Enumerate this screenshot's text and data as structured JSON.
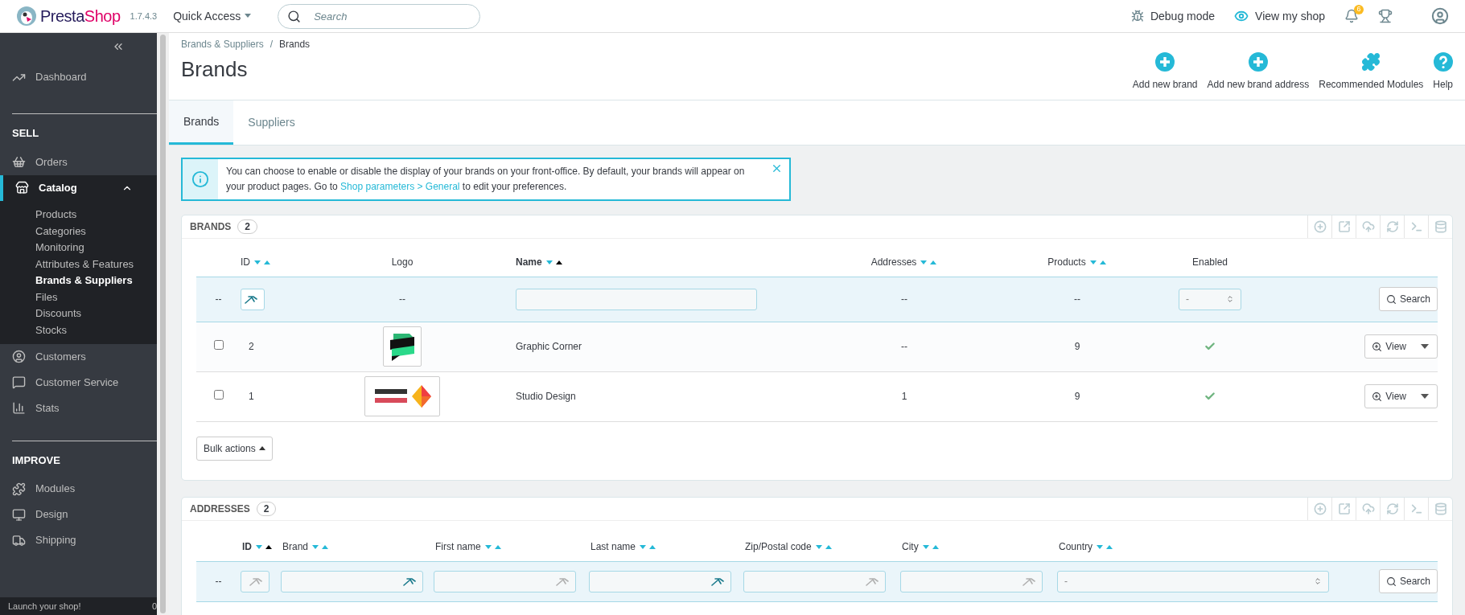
{
  "header": {
    "logo": {
      "first": "Presta",
      "second": "Shop"
    },
    "version": "1.7.4.3",
    "quick_access": "Quick Access",
    "search": {
      "placeholder": "Search"
    },
    "links": [
      {
        "label": "Debug mode"
      },
      {
        "label": "View my shop"
      }
    ],
    "notifications_badge": "6"
  },
  "sidebar": {
    "items": [
      {
        "kind": "item",
        "label": "Dashboard",
        "selected": false
      },
      {
        "kind": "section",
        "label": "SELL"
      },
      {
        "kind": "item",
        "label": "Orders",
        "selected": false
      },
      {
        "kind": "item",
        "label": "Catalog",
        "selected": true,
        "expanded": true,
        "children": [
          {
            "label": "Products",
            "selected": false
          },
          {
            "label": "Categories",
            "selected": false
          },
          {
            "label": "Monitoring",
            "selected": false
          },
          {
            "label": "Attributes & Features",
            "selected": false
          },
          {
            "label": "Brands & Suppliers",
            "selected": true
          },
          {
            "label": "Files",
            "selected": false
          },
          {
            "label": "Discounts",
            "selected": false
          },
          {
            "label": "Stocks",
            "selected": false
          }
        ]
      },
      {
        "kind": "item",
        "label": "Customers",
        "selected": false
      },
      {
        "kind": "item",
        "label": "Customer Service",
        "selected": false
      },
      {
        "kind": "item",
        "label": "Stats",
        "selected": false
      },
      {
        "kind": "section",
        "label": "IMPROVE"
      },
      {
        "kind": "item",
        "label": "Modules",
        "selected": false
      },
      {
        "kind": "item",
        "label": "Design",
        "selected": false
      },
      {
        "kind": "item",
        "label": "Shipping",
        "selected": false
      }
    ],
    "footer": {
      "label": "Launch your shop!",
      "percent": "0"
    }
  },
  "breadcrumb": [
    "Brands & Suppliers",
    "Brands"
  ],
  "breadcrumb_separator": "/",
  "page_title": "Brands",
  "actions": [
    {
      "label": "Add new brand"
    },
    {
      "label": "Add new brand address"
    },
    {
      "label": "Recommended Modules"
    },
    {
      "label": "Help"
    }
  ],
  "tabs": [
    {
      "label": "Brands",
      "selected": true
    },
    {
      "label": "Suppliers",
      "selected": false
    }
  ],
  "alert": {
    "text": "You can choose to enable or disable the display of your brands on your front-office. By default, your brands will appear on your product pages. Go to",
    "link": "Shop parameters > General",
    "text_after": "to edit your preferences."
  },
  "brands": {
    "title": "BRANDS",
    "count": "2",
    "columns": [
      {
        "label": "ID",
        "sortable": true,
        "sorted_asc": false
      },
      {
        "label": "Logo",
        "sortable": false
      },
      {
        "label": "Name",
        "sortable": true,
        "sorted_asc": true
      },
      {
        "label": "Addresses",
        "sortable": true,
        "sorted_asc": false
      },
      {
        "label": "Products",
        "sortable": true,
        "sorted_asc": false
      },
      {
        "label": "Enabled",
        "sortable": false
      }
    ],
    "filter": {
      "empty": "--",
      "logo": "--",
      "addresses": "--",
      "products": "--",
      "enabled": "-",
      "button": "Search"
    },
    "rows": [
      {
        "checked": false,
        "id": "2",
        "name": "Graphic Corner",
        "addresses": "--",
        "products": "9",
        "enabled": true,
        "action": "View"
      },
      {
        "checked": false,
        "id": "1",
        "name": "Studio Design",
        "addresses": "1",
        "products": "9",
        "enabled": true,
        "action": "View"
      }
    ],
    "bulk_actions": "Bulk actions"
  },
  "addresses": {
    "title": "ADDRESSES",
    "count": "2",
    "columns": [
      {
        "label": "ID",
        "sortable": true,
        "sorted_asc": true
      },
      {
        "label": "Brand",
        "sortable": true,
        "sorted_asc": false
      },
      {
        "label": "First name",
        "sortable": true,
        "sorted_asc": false
      },
      {
        "label": "Last name",
        "sortable": true,
        "sorted_asc": false
      },
      {
        "label": "Zip/Postal code",
        "sortable": true,
        "sorted_asc": false
      },
      {
        "label": "City",
        "sortable": true,
        "sorted_asc": false
      },
      {
        "label": "Country",
        "sortable": true,
        "sorted_asc": false
      }
    ],
    "filter": {
      "empty": "--",
      "fields": [
        {
          "autofill_active": false
        },
        {
          "autofill_active": true
        },
        {
          "autofill_active": false
        },
        {
          "autofill_active": true
        },
        {
          "autofill_active": false
        },
        {
          "autofill_active": false
        }
      ],
      "country": "-",
      "button": "Search"
    }
  }
}
